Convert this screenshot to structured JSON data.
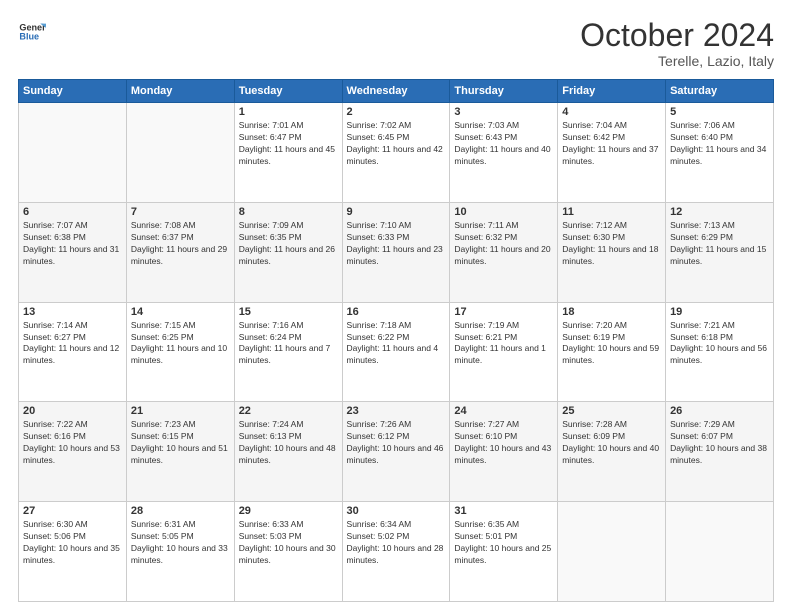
{
  "header": {
    "logo_line1": "General",
    "logo_line2": "Blue",
    "month": "October 2024",
    "location": "Terelle, Lazio, Italy"
  },
  "days_of_week": [
    "Sunday",
    "Monday",
    "Tuesday",
    "Wednesday",
    "Thursday",
    "Friday",
    "Saturday"
  ],
  "weeks": [
    [
      {
        "num": "",
        "info": ""
      },
      {
        "num": "",
        "info": ""
      },
      {
        "num": "1",
        "info": "Sunrise: 7:01 AM\nSunset: 6:47 PM\nDaylight: 11 hours and 45 minutes."
      },
      {
        "num": "2",
        "info": "Sunrise: 7:02 AM\nSunset: 6:45 PM\nDaylight: 11 hours and 42 minutes."
      },
      {
        "num": "3",
        "info": "Sunrise: 7:03 AM\nSunset: 6:43 PM\nDaylight: 11 hours and 40 minutes."
      },
      {
        "num": "4",
        "info": "Sunrise: 7:04 AM\nSunset: 6:42 PM\nDaylight: 11 hours and 37 minutes."
      },
      {
        "num": "5",
        "info": "Sunrise: 7:06 AM\nSunset: 6:40 PM\nDaylight: 11 hours and 34 minutes."
      }
    ],
    [
      {
        "num": "6",
        "info": "Sunrise: 7:07 AM\nSunset: 6:38 PM\nDaylight: 11 hours and 31 minutes."
      },
      {
        "num": "7",
        "info": "Sunrise: 7:08 AM\nSunset: 6:37 PM\nDaylight: 11 hours and 29 minutes."
      },
      {
        "num": "8",
        "info": "Sunrise: 7:09 AM\nSunset: 6:35 PM\nDaylight: 11 hours and 26 minutes."
      },
      {
        "num": "9",
        "info": "Sunrise: 7:10 AM\nSunset: 6:33 PM\nDaylight: 11 hours and 23 minutes."
      },
      {
        "num": "10",
        "info": "Sunrise: 7:11 AM\nSunset: 6:32 PM\nDaylight: 11 hours and 20 minutes."
      },
      {
        "num": "11",
        "info": "Sunrise: 7:12 AM\nSunset: 6:30 PM\nDaylight: 11 hours and 18 minutes."
      },
      {
        "num": "12",
        "info": "Sunrise: 7:13 AM\nSunset: 6:29 PM\nDaylight: 11 hours and 15 minutes."
      }
    ],
    [
      {
        "num": "13",
        "info": "Sunrise: 7:14 AM\nSunset: 6:27 PM\nDaylight: 11 hours and 12 minutes."
      },
      {
        "num": "14",
        "info": "Sunrise: 7:15 AM\nSunset: 6:25 PM\nDaylight: 11 hours and 10 minutes."
      },
      {
        "num": "15",
        "info": "Sunrise: 7:16 AM\nSunset: 6:24 PM\nDaylight: 11 hours and 7 minutes."
      },
      {
        "num": "16",
        "info": "Sunrise: 7:18 AM\nSunset: 6:22 PM\nDaylight: 11 hours and 4 minutes."
      },
      {
        "num": "17",
        "info": "Sunrise: 7:19 AM\nSunset: 6:21 PM\nDaylight: 11 hours and 1 minute."
      },
      {
        "num": "18",
        "info": "Sunrise: 7:20 AM\nSunset: 6:19 PM\nDaylight: 10 hours and 59 minutes."
      },
      {
        "num": "19",
        "info": "Sunrise: 7:21 AM\nSunset: 6:18 PM\nDaylight: 10 hours and 56 minutes."
      }
    ],
    [
      {
        "num": "20",
        "info": "Sunrise: 7:22 AM\nSunset: 6:16 PM\nDaylight: 10 hours and 53 minutes."
      },
      {
        "num": "21",
        "info": "Sunrise: 7:23 AM\nSunset: 6:15 PM\nDaylight: 10 hours and 51 minutes."
      },
      {
        "num": "22",
        "info": "Sunrise: 7:24 AM\nSunset: 6:13 PM\nDaylight: 10 hours and 48 minutes."
      },
      {
        "num": "23",
        "info": "Sunrise: 7:26 AM\nSunset: 6:12 PM\nDaylight: 10 hours and 46 minutes."
      },
      {
        "num": "24",
        "info": "Sunrise: 7:27 AM\nSunset: 6:10 PM\nDaylight: 10 hours and 43 minutes."
      },
      {
        "num": "25",
        "info": "Sunrise: 7:28 AM\nSunset: 6:09 PM\nDaylight: 10 hours and 40 minutes."
      },
      {
        "num": "26",
        "info": "Sunrise: 7:29 AM\nSunset: 6:07 PM\nDaylight: 10 hours and 38 minutes."
      }
    ],
    [
      {
        "num": "27",
        "info": "Sunrise: 6:30 AM\nSunset: 5:06 PM\nDaylight: 10 hours and 35 minutes."
      },
      {
        "num": "28",
        "info": "Sunrise: 6:31 AM\nSunset: 5:05 PM\nDaylight: 10 hours and 33 minutes."
      },
      {
        "num": "29",
        "info": "Sunrise: 6:33 AM\nSunset: 5:03 PM\nDaylight: 10 hours and 30 minutes."
      },
      {
        "num": "30",
        "info": "Sunrise: 6:34 AM\nSunset: 5:02 PM\nDaylight: 10 hours and 28 minutes."
      },
      {
        "num": "31",
        "info": "Sunrise: 6:35 AM\nSunset: 5:01 PM\nDaylight: 10 hours and 25 minutes."
      },
      {
        "num": "",
        "info": ""
      },
      {
        "num": "",
        "info": ""
      }
    ]
  ]
}
